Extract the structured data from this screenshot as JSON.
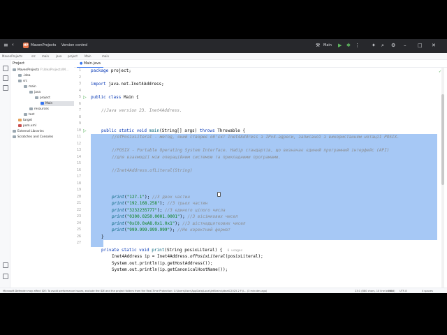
{
  "titlebar": {
    "project_badge": "MP",
    "project": "MavenProjects",
    "vcs": "Version control",
    "run_config": "Main"
  },
  "breadcrumbs": [
    "MavenProjects",
    "src",
    "main",
    "java",
    "project",
    "Main",
    "main"
  ],
  "project_panel": {
    "title": "Project",
    "tree": [
      {
        "label": "MavenProjects",
        "suffix": "F:\\IdeaProjects\\M..."
      },
      {
        "label": ".idea"
      },
      {
        "label": "src"
      },
      {
        "label": "main"
      },
      {
        "label": "java"
      },
      {
        "label": "project"
      },
      {
        "label": "Main"
      },
      {
        "label": "resources"
      },
      {
        "label": "test"
      },
      {
        "label": "target"
      },
      {
        "label": "pom.xml"
      },
      {
        "label": "External Libraries"
      },
      {
        "label": "Scratches and Consoles"
      }
    ]
  },
  "editor": {
    "tab": "Main.java",
    "lines": [
      {
        "n": "1"
      },
      {
        "n": "2"
      },
      {
        "n": "3"
      },
      {
        "n": "4"
      },
      {
        "n": "5"
      },
      {
        "n": "6"
      },
      {
        "n": "7"
      },
      {
        "n": "8"
      },
      {
        "n": "9"
      },
      {
        "n": "10"
      },
      {
        "n": "11"
      },
      {
        "n": "12"
      },
      {
        "n": "13"
      },
      {
        "n": "14"
      },
      {
        "n": "15"
      },
      {
        "n": "16"
      },
      {
        "n": "17"
      },
      {
        "n": "18"
      },
      {
        "n": "19"
      },
      {
        "n": "20"
      },
      {
        "n": "21"
      },
      {
        "n": "22"
      },
      {
        "n": "23"
      },
      {
        "n": "24"
      },
      {
        "n": "25"
      },
      {
        "n": "26"
      },
      {
        "n": "27"
      }
    ],
    "code": {
      "package_kw": "package",
      "package_name": " project;",
      "import_kw": "import",
      "import_name": " java.net.Inet4Address;",
      "class_kw": "public class",
      "class_name": " Main {",
      "comment_version": "//Java version 23. Inet4Address.",
      "main_kw": "public static void",
      "main_fn": " main",
      "main_rest": "(String[] args) ",
      "throws_kw": "throws",
      "throws_rest": " Throwable {",
      "c1": "//ofPosixLiteral - метод, який створює об'єкт Inet4Address з IPv4-адреси, записаної з використанням нотації POSIX.",
      "c2": "//POSIX - Portable Operating System Interface. Набір стандартів, що визначає єдиний програмний інтерфейс (API)",
      "c3": "//для взаємодії між операційним системою та прикладними програмами.",
      "c4": "//Inet4Address.ofLiteral(String)",
      "p_fn": "print",
      "p1_str": "\"127.1\"",
      "p1_cm": "//3 двох частин",
      "p2_str": "\"192.168.258\"",
      "p2_cm": "//3 трьох частин",
      "p3_str": "\"3232235777\"",
      "p3_cm": "//3 єдиного цілого числа",
      "p4_str": "\"0300.0250.0001.0001\"",
      "p4_cm": "//3 вісімкових чисел",
      "p5_str": "\"0xC0.0xA8.0x1.0x1\"",
      "p5_cm": "//3 шістнадцяткових чисел",
      "p6_str": "\"999.999.999.999\"",
      "p6_cm": "//Не коректний формат",
      "close_brace": "}",
      "print_kw": "private static void",
      "print_fn": " print",
      "print_rest": "(String posixLiteral) {",
      "usages": "6 usages",
      "l25": "Inet4Address ip = Inet4Address.",
      "l25_it": "ofPosixLiteral",
      "l25_end": "(posixLiteral);",
      "l26": "System.out.println(ip.getHostAddress());",
      "l27": "System.out.println(ip.getCanonicalHostName());"
    }
  },
  "status_bar": {
    "message": "Microsoft Defender may affect IDE: To avoid performance issues, exclude the IDE and the project folders from the Real-Time Protection: C:\\Users\\User\\AppData\\Local\\JetBrains\\IdeaIC2025.2 F:\\I... (3 minutes ago)",
    "position": "23:1 (880 chars, 10 line breaks)",
    "line_sep": "CRLF",
    "encoding": "UTF-8",
    "indent": "4 spaces"
  }
}
